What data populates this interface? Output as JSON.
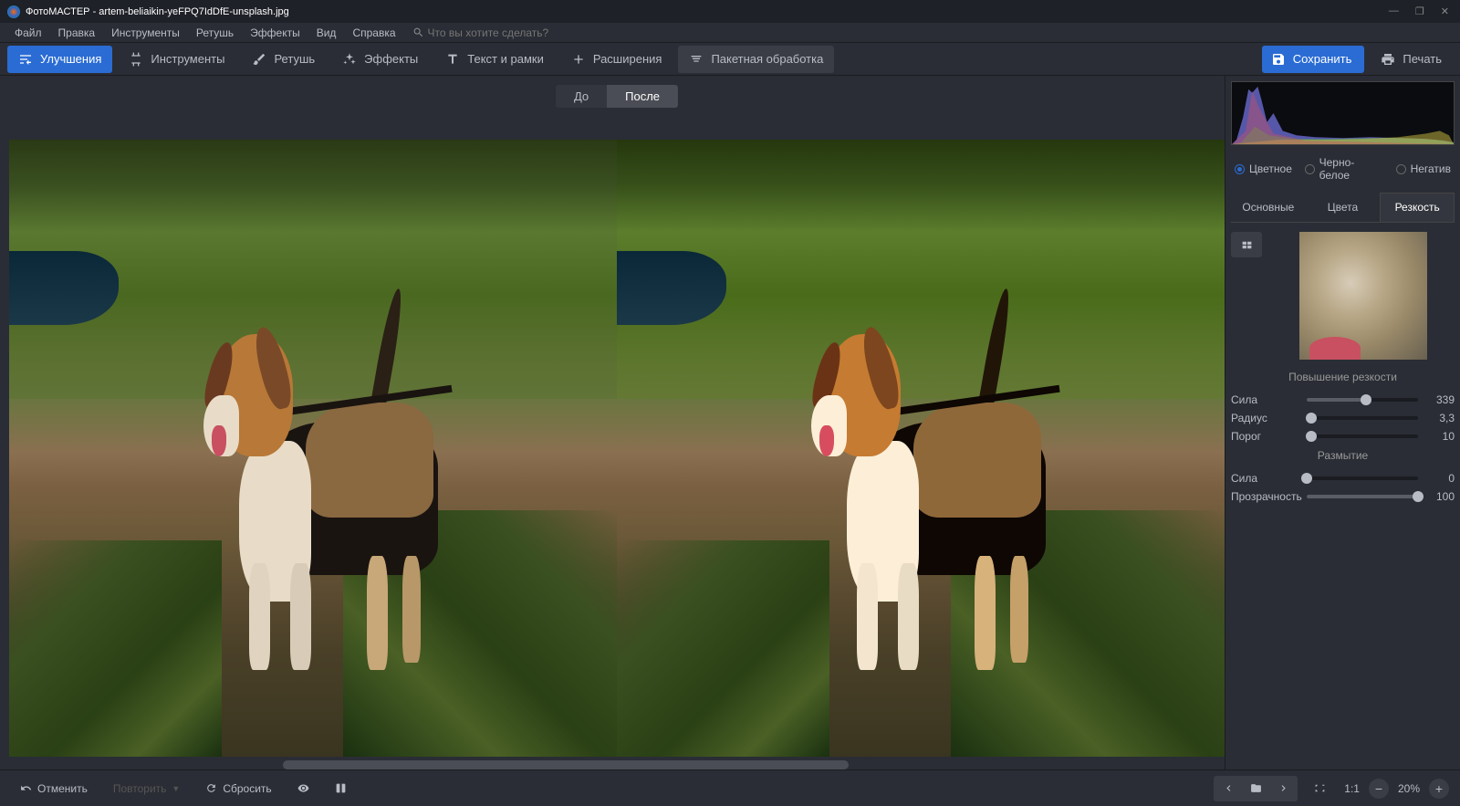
{
  "titlebar": {
    "app": "ФотоМАСТЕР",
    "file": "artem-beliaikin-yeFPQ7IdDfE-unsplash.jpg"
  },
  "menu": {
    "items": [
      "Файл",
      "Правка",
      "Инструменты",
      "Ретушь",
      "Эффекты",
      "Вид",
      "Справка"
    ],
    "search_placeholder": "Что вы хотите сделать?"
  },
  "toolbar": {
    "enhance": "Улучшения",
    "tools": "Инструменты",
    "retouch": "Ретушь",
    "effects": "Эффекты",
    "text": "Текст и рамки",
    "extensions": "Расширения",
    "batch": "Пакетная обработка",
    "save": "Сохранить",
    "print": "Печать"
  },
  "compare": {
    "before": "До",
    "after": "После"
  },
  "color_mode": {
    "color": "Цветное",
    "bw": "Черно-белое",
    "negative": "Негатив"
  },
  "panel_tabs": {
    "basic": "Основные",
    "colors": "Цвета",
    "sharpness": "Резкость"
  },
  "sharpening": {
    "title": "Повышение резкости",
    "strength_label": "Сила",
    "strength_val": "339",
    "strength_pct": 53,
    "radius_label": "Радиус",
    "radius_val": "3,3",
    "radius_pct": 4,
    "threshold_label": "Порог",
    "threshold_val": "10",
    "threshold_pct": 4
  },
  "blur": {
    "title": "Размытие",
    "strength_label": "Сила",
    "strength_val": "0",
    "strength_pct": 0,
    "opacity_label": "Прозрачность",
    "opacity_val": "100",
    "opacity_pct": 100
  },
  "bottom": {
    "undo": "Отменить",
    "redo": "Повторить",
    "reset": "Сбросить",
    "ratio": "1:1",
    "zoom": "20%"
  }
}
